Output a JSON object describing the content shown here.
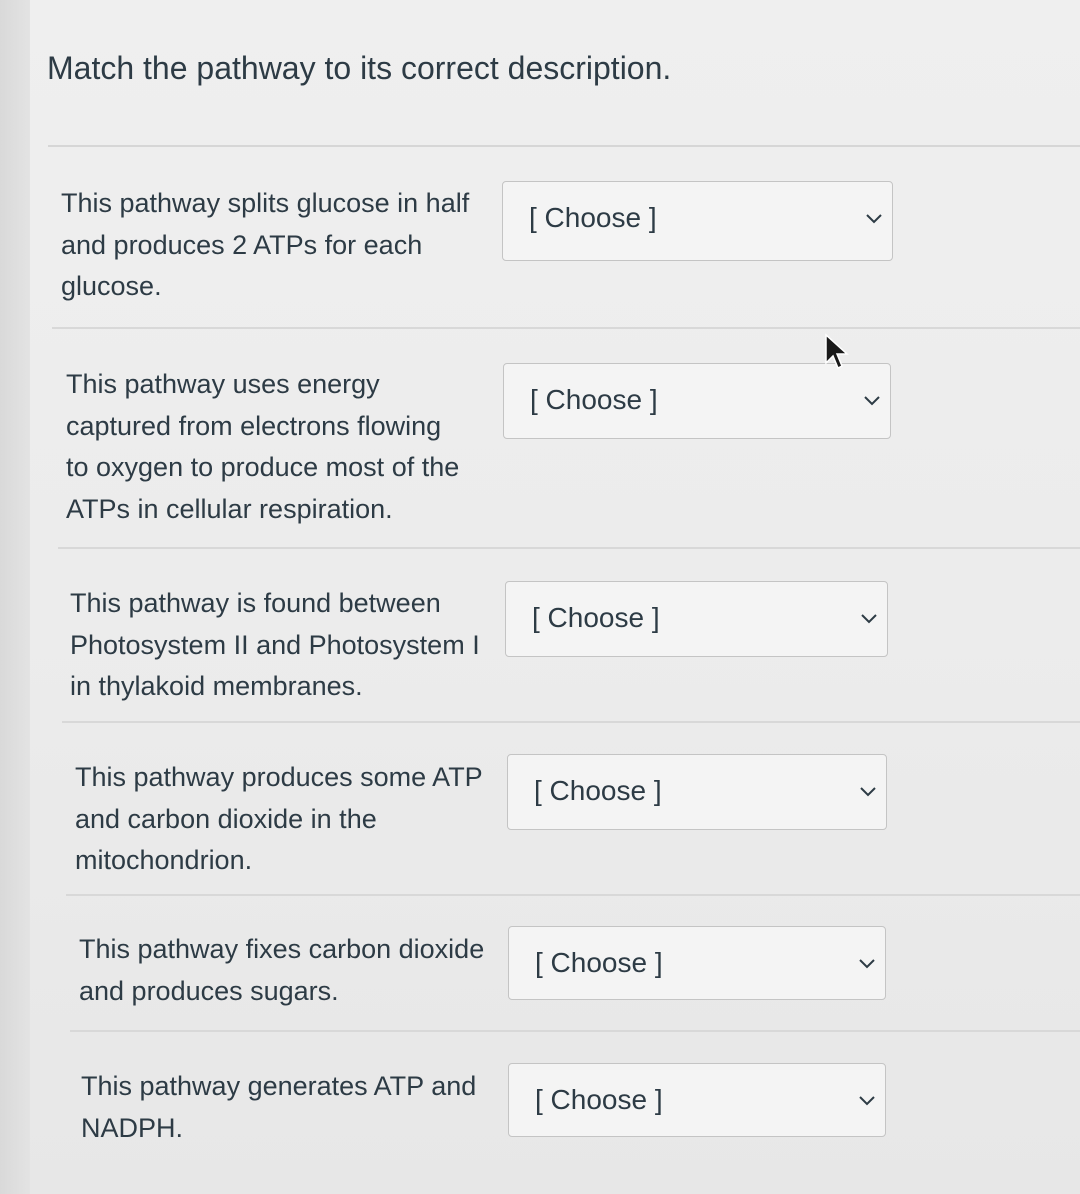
{
  "question": {
    "title": "Match the pathway to its correct description."
  },
  "rows": [
    {
      "lines": [
        "This pathway splits glucose in half",
        "and produces 2 ATPs for each",
        "glucose."
      ],
      "select_value": "[ Choose ]"
    },
    {
      "lines": [
        "This pathway uses energy",
        "captured from electrons flowing",
        "to oxygen to produce most of the",
        "ATPs in cellular respiration."
      ],
      "select_value": "[ Choose ]"
    },
    {
      "lines": [
        "This pathway is found between",
        "Photosystem II and Photosystem I",
        "in thylakoid membranes."
      ],
      "select_value": "[ Choose ]"
    },
    {
      "lines": [
        "This pathway produces some ATP",
        "and carbon dioxide in the",
        "mitochondrion."
      ],
      "select_value": "[ Choose ]"
    },
    {
      "lines": [
        "This pathway fixes carbon dioxide",
        "and produces sugars."
      ],
      "select_value": "[ Choose ]"
    },
    {
      "lines": [
        "This pathway generates ATP and",
        "NADPH."
      ],
      "select_value": "[ Choose ]"
    }
  ],
  "icons": {
    "select_arrow": "chevron-down-icon",
    "pointer": "mouse-cursor-icon"
  }
}
